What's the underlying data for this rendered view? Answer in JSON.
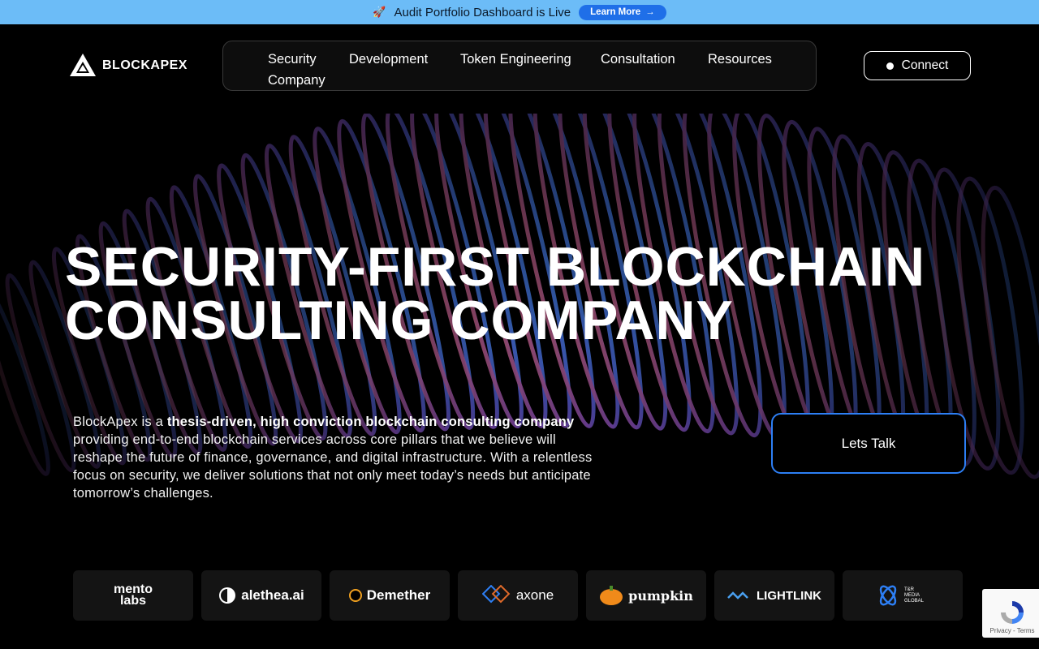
{
  "announcement": {
    "text": "Audit Portfolio Dashboard is Live",
    "button_label": "Learn More"
  },
  "header": {
    "logo_text": "BLOCKAPEX",
    "nav": [
      "Security",
      "Development",
      "Token Engineering",
      "Consultation",
      "Resources",
      "Company"
    ],
    "connect_label": "Connect"
  },
  "hero": {
    "headline_line1": "SECURITY-FIRST BLOCKCHAIN",
    "headline_line2": "CONSULTING COMPANY",
    "desc_prefix": "BlockApex is a ",
    "desc_bold": "thesis-driven, high conviction blockchain consulting company",
    "desc_rest": " providing end-to-end blockchain services across core pillars that we believe will reshape the future of finance, governance, and digital infrastructure. With a relentless focus on security, we deliver solutions that not only meet today’s needs but anticipate tomorrow’s challenges.",
    "cta_label": "Lets Talk"
  },
  "partners": [
    {
      "label": "mento labs",
      "icon": "mento-logo"
    },
    {
      "label": "alethea.ai",
      "icon": "alethea-logo"
    },
    {
      "label": "Demether",
      "icon": "demether-logo"
    },
    {
      "label": "axone",
      "icon": "axone-logo"
    },
    {
      "label": "pumpkin",
      "icon": "pumpkin-logo"
    },
    {
      "label": "LIGHTLINK",
      "icon": "lightlink-logo"
    },
    {
      "label": "T&R MEDIA GLOBAL",
      "icon": "tr-media-logo"
    }
  ],
  "recaptcha": {
    "links": "Privacy - Terms"
  },
  "colors": {
    "announce_bg": "#6cbcf7",
    "accent_blue": "#2d7ff5",
    "background": "#000000"
  }
}
